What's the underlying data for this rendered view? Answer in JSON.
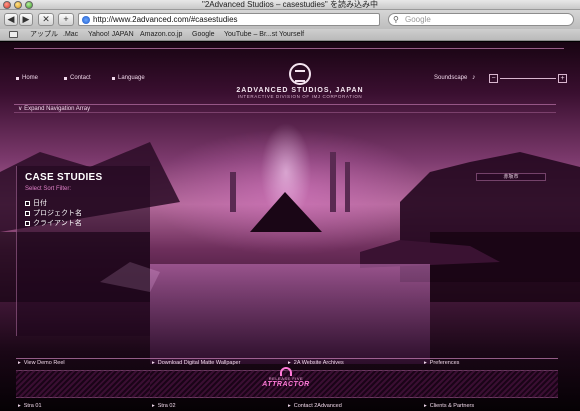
{
  "browser": {
    "title": "\"2Advanced Studios – casestudies\" を読み込み中",
    "url": "http://www.2advanced.com/#casestudies",
    "search_placeholder": "Google",
    "back_label": "◀",
    "forward_label": "▶",
    "stop_label": "✕",
    "add_label": "+",
    "bookmarks": [
      "アップル",
      ".Mac",
      "Yahoo! JAPAN",
      "Amazon.co.jp",
      "Google",
      "YouTube – Br...st Yourself"
    ]
  },
  "site": {
    "nav": [
      "Home",
      "Contact",
      "Language"
    ],
    "logo_title": "2ADVANCED STUDIOS, JAPAN",
    "logo_subtitle": "INTERACTIVE DIVISION OF IMJ CORPORATION",
    "soundscape_label": "Soundscape",
    "vol_minus": "−",
    "vol_plus": "+",
    "expand_label": "Expand Navigation Array",
    "case_studies": {
      "title": "CASE STUDIES",
      "subtitle": "Select Sort Filter:",
      "filters": [
        "日付",
        "プロジェクト名",
        "クライアント名"
      ]
    },
    "location_tag": "赤坂市",
    "bottom": {
      "top_links": [
        "View Demo Reel",
        "Download Digital Matte Wallpaper",
        "2A Website Archives",
        "Preferences"
      ],
      "bottom_links": [
        "Stra 01",
        "Stra 02",
        "Contact 2Advanced",
        "Clients & Partners"
      ],
      "promo_kicker": "RELEASE FIVE",
      "promo_title": "ATTRACTOR"
    }
  },
  "colors": {
    "accent": "#ff7ad8",
    "sky": "#b46a9b",
    "panel": "#1e061c"
  }
}
